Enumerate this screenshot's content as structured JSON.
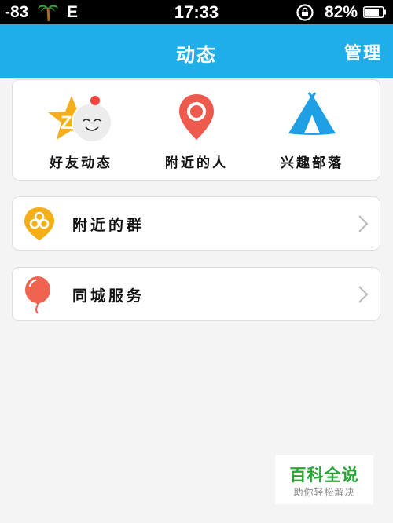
{
  "status_bar": {
    "signal": "-83",
    "network": "E",
    "time": "17:33",
    "battery": "82%"
  },
  "header": {
    "title": "动态",
    "manage_label": "管理"
  },
  "quick_actions": [
    {
      "label": "好友动态",
      "icon": "qzone-star-icon",
      "has_notification_dot": true
    },
    {
      "label": "附近的人",
      "icon": "location-pin-icon"
    },
    {
      "label": "兴趣部落",
      "icon": "tent-icon"
    }
  ],
  "list": [
    {
      "label": "附近的群",
      "icon": "nearby-group-icon"
    },
    {
      "label": "同城服务",
      "icon": "balloon-icon"
    }
  ],
  "watermark": {
    "title": "百科全说",
    "subtitle": "助你轻松解决"
  },
  "colors": {
    "header": "#1faee8",
    "notification_dot": "#f4443b",
    "star": "#f6ad1c",
    "pin": "#ee5a4d",
    "tent": "#1f9fe4",
    "group": "#f3ae18",
    "balloon": "#ef6450"
  }
}
